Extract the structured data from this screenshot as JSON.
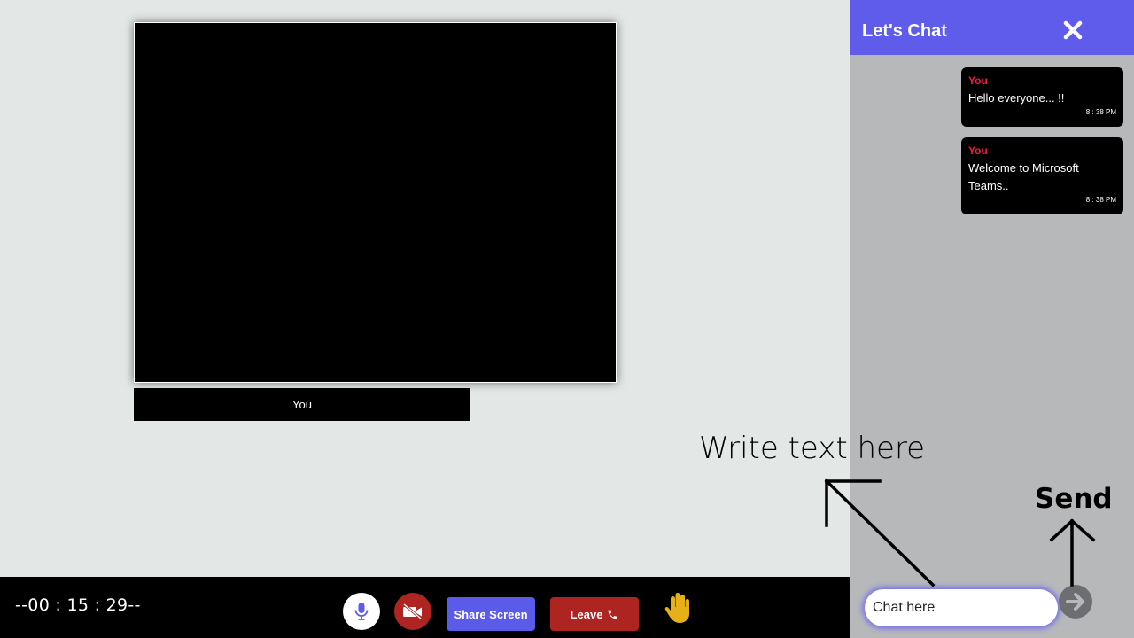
{
  "video": {
    "participant_name": "You"
  },
  "controls": {
    "timer": "--00 : 15 : 29--",
    "mic_icon": "microphone-icon",
    "camera_icon": "video-off-icon",
    "share_label": "Share Screen",
    "leave_label": "Leave",
    "leave_icon": "phone-icon",
    "hand_icon": "raise-hand-icon"
  },
  "chat": {
    "title": "Let's Chat",
    "close_icon": "close-icon",
    "messages": [
      {
        "sender": "You",
        "text": "Hello everyone... !!",
        "time": "8 : 38 PM"
      },
      {
        "sender": "You",
        "text": "Welcome to Microsoft Teams..",
        "time": "8 : 38 PM"
      }
    ],
    "input_placeholder": "Chat here",
    "send_icon": "arrow-right-icon"
  },
  "annotations": {
    "write_text": "Write text here",
    "send_text": "Send"
  },
  "colors": {
    "accent": "#5f5cec",
    "danger": "#ad2421",
    "chat_bg": "#b7b8ba",
    "page_bg": "#e3e7e6",
    "sender_name": "#ee1d3a"
  }
}
